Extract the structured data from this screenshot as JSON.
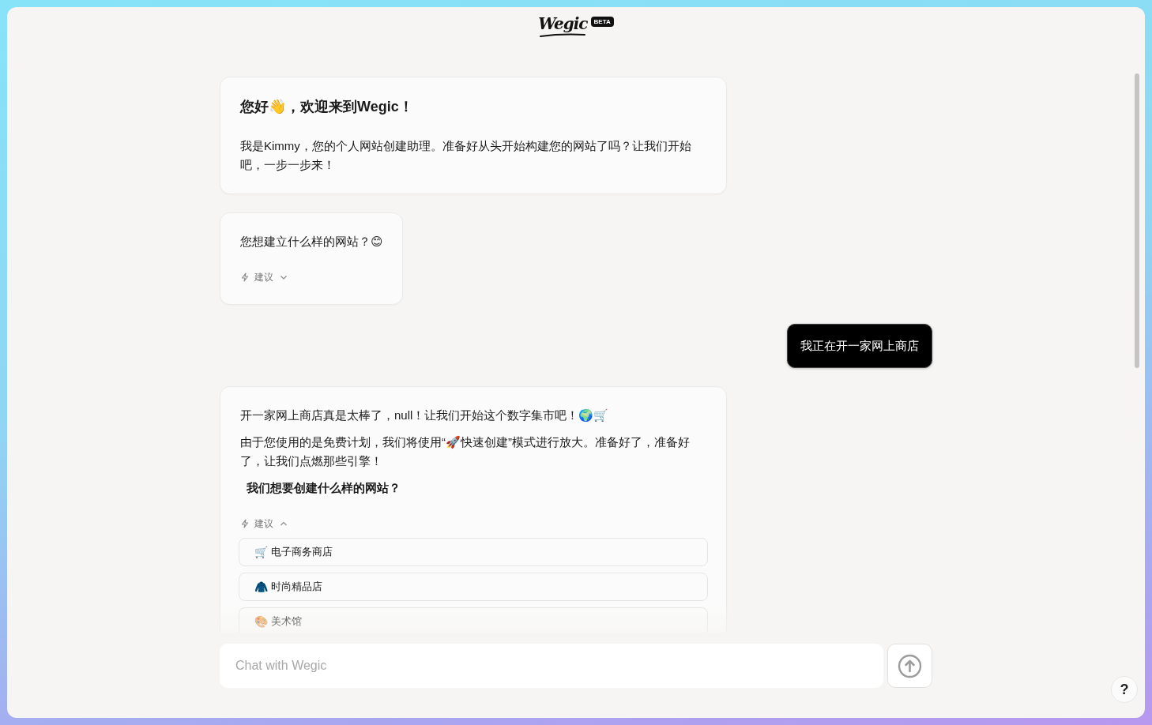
{
  "header": {
    "logo": "Wegic",
    "badge": "BETA"
  },
  "messages": [
    {
      "kind": "bot",
      "title": "您好👋，欢迎来到Wegic！",
      "paragraphs": [
        "我是Kimmy，您的个人网站创建助理。准备好从头开始构建您的网站了吗？让我们开始吧，一步一步来！"
      ]
    },
    {
      "kind": "bot",
      "paragraphs": [
        "您想建立什么样的网站？😊"
      ],
      "suggestions": {
        "label": "建议",
        "expanded": false
      }
    },
    {
      "kind": "user",
      "text": "我正在开一家网上商店"
    },
    {
      "kind": "bot",
      "paragraphs": [
        "开一家网上商店真是太棒了，null！让我们开始这个数字集市吧！🌍🛒",
        "由于您使用的是免费计划，我们将使用“🚀快速创建”模式进行放大。准备好了，准备好了，让我们点燃那些引擎！"
      ],
      "question": "我们想要创建什么样的网站？",
      "suggestions": {
        "label": "建议",
        "expanded": true,
        "items": [
          {
            "icon": "🛒",
            "label": "电子商务商店"
          },
          {
            "icon": "🧥",
            "label": "时尚精品店"
          },
          {
            "icon": "🎨",
            "label": "美术馆"
          }
        ]
      }
    }
  ],
  "composer": {
    "placeholder": "Chat with Wegic"
  },
  "help_button": "?"
}
